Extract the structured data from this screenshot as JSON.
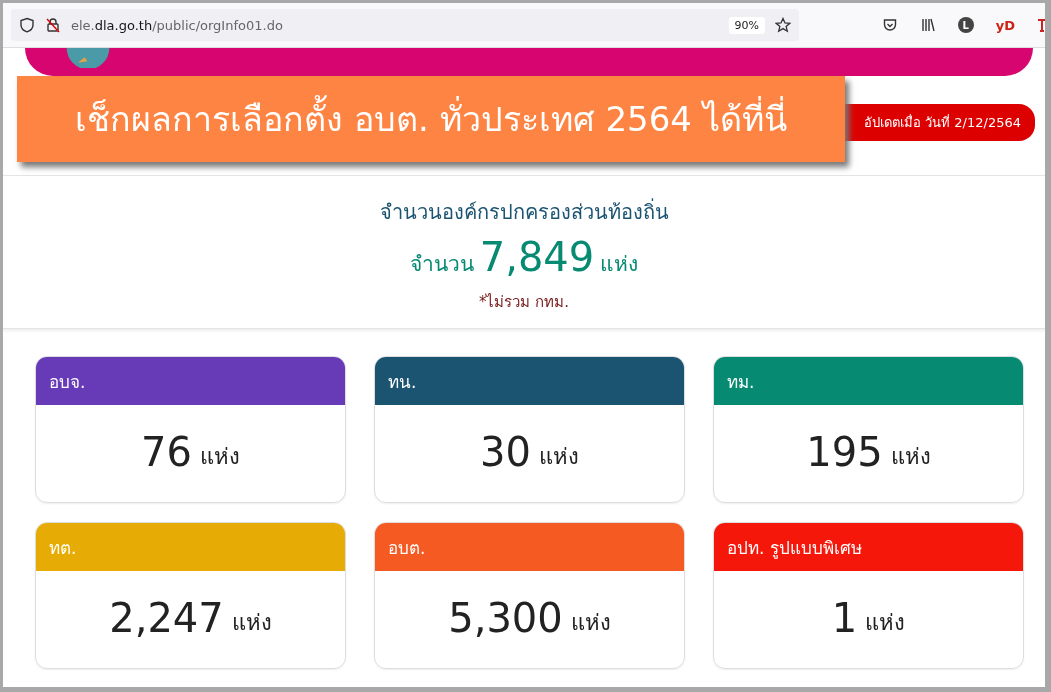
{
  "browser": {
    "url": "ele.**dla.go.th**/public/orgInfo01.do",
    "zoom": "90%",
    "avatar": "L",
    "extension": "yD"
  },
  "banner": {
    "text": "เช็กผลการเลือกตั้ง อบต. ทั่วประเทศ 2564 ได้ที่นี่"
  },
  "update_badge": "อัปเดตเมื่อ วันที่ 2/12/2564",
  "summary": {
    "title": "จำนวนองค์กรปกครองส่วนท้องถิ่น",
    "count_label": "จำนวน",
    "count": "7,849",
    "unit": "แห่ง",
    "note": "*ไม่รวม กทม."
  },
  "cards": [
    {
      "title": "อบจ.",
      "count": "76",
      "unit": "แห่ง",
      "color": "#673ab7"
    },
    {
      "title": "ทน.",
      "count": "30",
      "unit": "แห่ง",
      "color": "#1b5471"
    },
    {
      "title": "ทม.",
      "count": "195",
      "unit": "แห่ง",
      "color": "#078a72"
    },
    {
      "title": "ทต.",
      "count": "2,247",
      "unit": "แห่ง",
      "color": "#e6ac05"
    },
    {
      "title": "อบต.",
      "count": "5,300",
      "unit": "แห่ง",
      "color": "#f55a23"
    },
    {
      "title": "อปท. รูปแบบพิเศษ",
      "count": "1",
      "unit": "แห่ง",
      "color": "#f5170a"
    }
  ]
}
